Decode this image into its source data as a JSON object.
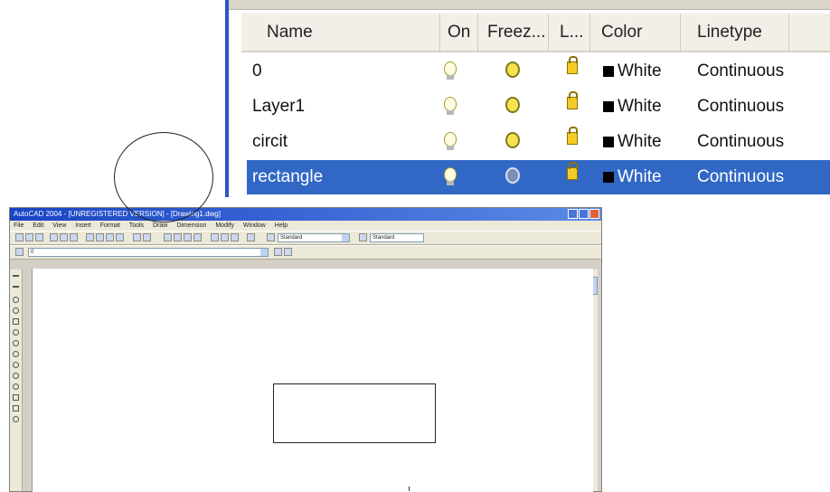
{
  "layer_panel": {
    "columns": [
      "Name",
      "On",
      "Freez...",
      "L...",
      "Color",
      "Linetype"
    ],
    "rows": [
      {
        "name": "0",
        "color": "White",
        "linetype": "Continuous",
        "selected": false
      },
      {
        "name": "Layer1",
        "color": "White",
        "linetype": "Continuous",
        "selected": false
      },
      {
        "name": "circit",
        "color": "White",
        "linetype": "Continuous",
        "selected": false
      },
      {
        "name": "rectangle",
        "color": "White",
        "linetype": "Continuous",
        "selected": true
      }
    ]
  },
  "acad": {
    "title": "AutoCAD 2004 - [UNREGISTERED VERSION] - [Drawing1.dwg]",
    "menus": [
      "File",
      "Edit",
      "View",
      "Insert",
      "Format",
      "Tools",
      "Draw",
      "Dimension",
      "Modify",
      "Window",
      "Help"
    ],
    "style_combo": "Standard",
    "dimstyle_combo": "Standard",
    "layer_combo": "0"
  },
  "colors": {
    "accent": "#3168c5",
    "titlebar": "#1843c4"
  }
}
